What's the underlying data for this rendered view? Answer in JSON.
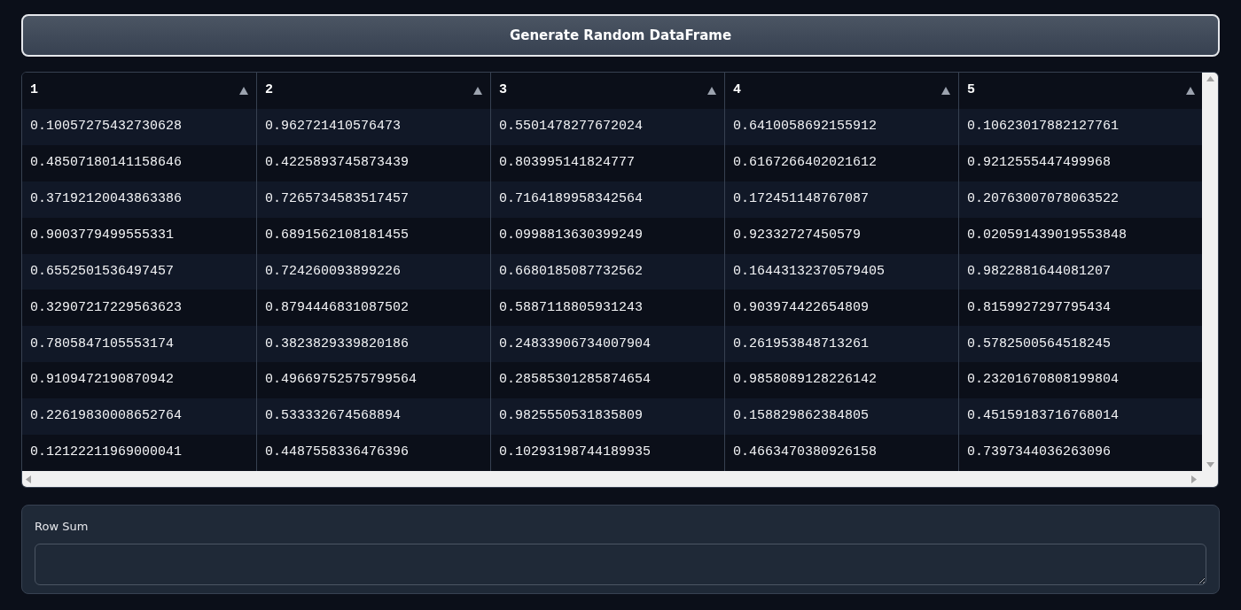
{
  "generate_button": {
    "label": "Generate Random DataFrame"
  },
  "table": {
    "columns": [
      {
        "label": "1"
      },
      {
        "label": "2"
      },
      {
        "label": "3"
      },
      {
        "label": "4"
      },
      {
        "label": "5"
      }
    ],
    "rows": [
      [
        "0.10057275432730628",
        "0.962721410576473",
        "0.5501478277672024",
        "0.6410058692155912",
        "0.10623017882127761"
      ],
      [
        "0.48507180141158646",
        "0.4225893745873439",
        "0.803995141824777",
        "0.6167266402021612",
        "0.9212555447499968"
      ],
      [
        "0.37192120043863386",
        "0.7265734583517457",
        "0.7164189958342564",
        "0.172451148767087",
        "0.20763007078063522"
      ],
      [
        "0.9003779499555331",
        "0.6891562108181455",
        "0.0998813630399249",
        "0.92332727450579",
        "0.020591439019553848"
      ],
      [
        "0.6552501536497457",
        "0.724260093899226",
        "0.6680185087732562",
        "0.16443132370579405",
        "0.9822881644081207"
      ],
      [
        "0.32907217229563623",
        "0.8794446831087502",
        "0.5887118805931243",
        "0.903974422654809",
        "0.8159927297795434"
      ],
      [
        "0.7805847105553174",
        "0.3823829339820186",
        "0.24833906734007904",
        "0.261953848713261",
        "0.5782500564518245"
      ],
      [
        "0.9109472190870942",
        "0.49669752575799564",
        "0.28585301285874654",
        "0.9858089128226142",
        "0.23201670808199804"
      ],
      [
        "0.22619830008652764",
        "0.533332674568894",
        "0.9825550531835809",
        "0.158829862384805",
        "0.45159183716768014"
      ],
      [
        "0.12122211969000041",
        "0.4487558336476396",
        "0.10293198744189935",
        "0.4663470380926158",
        "0.7397344036263096"
      ]
    ]
  },
  "output": {
    "label": "Row Sum"
  }
}
